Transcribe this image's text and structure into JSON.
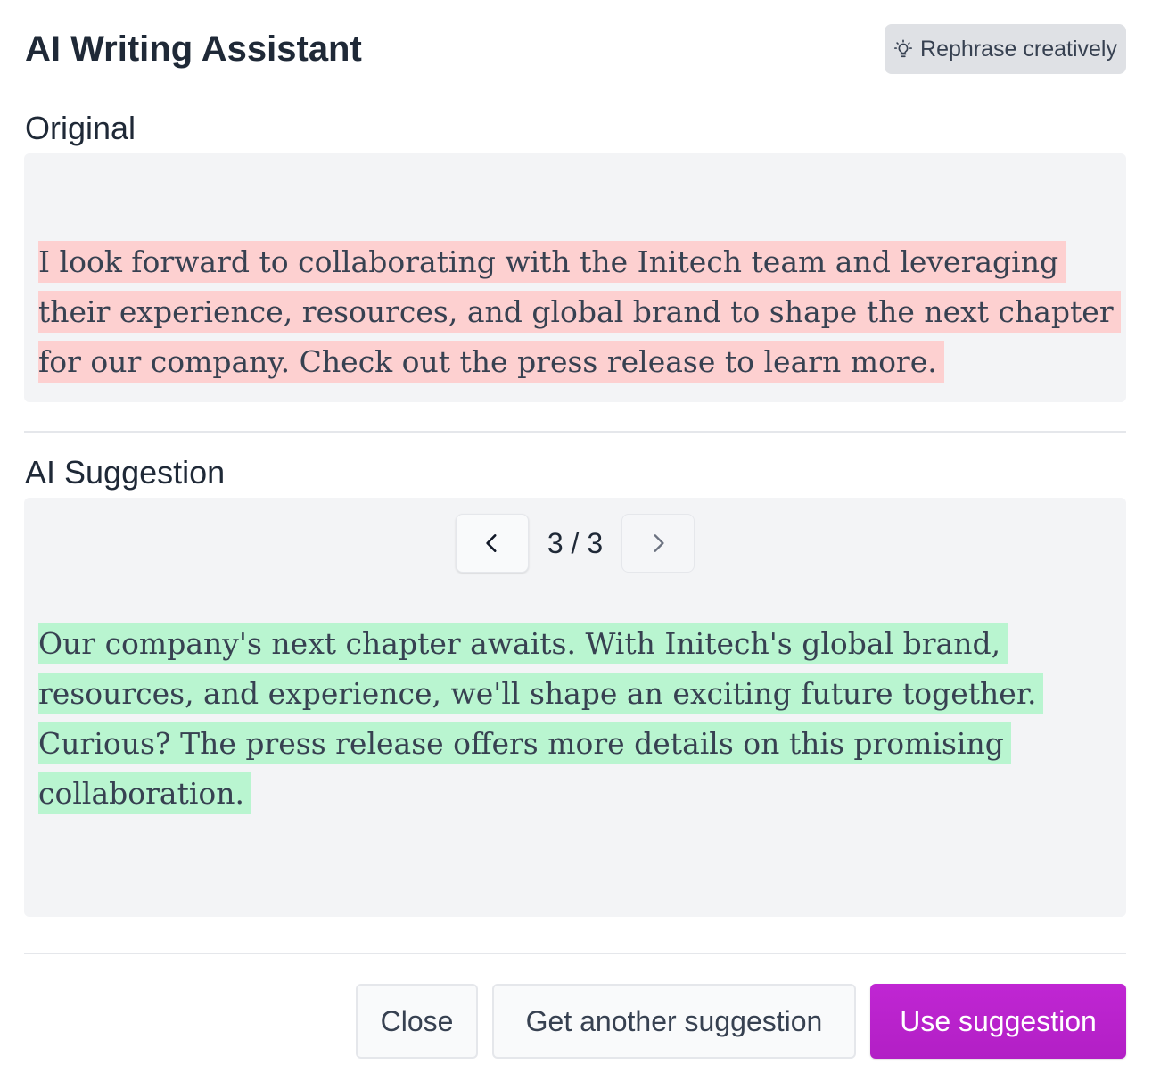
{
  "dialog": {
    "title": "AI Writing Assistant",
    "rephrase_button": {
      "label": "Rephrase creatively",
      "icon": "lightbulb-icon"
    }
  },
  "original": {
    "label": "Original",
    "text": "I look forward to collaborating with the Initech team and leveraging their experience, resources, and global brand to shape the next chapter for our company. Check out the press release to learn more."
  },
  "suggestion": {
    "label": "AI Suggestion",
    "pager": {
      "current": 3,
      "total": 3,
      "display": "3 / 3",
      "prev_icon": "chevron-left-icon",
      "next_icon": "chevron-right-icon"
    },
    "text": "Our company's next chapter awaits. With Initech's global brand, resources, and experience, we'll shape an exciting future together. Curious? The press release offers more details on this promising collaboration."
  },
  "footer": {
    "close_label": "Close",
    "another_label": "Get another suggestion",
    "use_label": "Use suggestion"
  },
  "colors": {
    "accent": "#c026d3",
    "removed_highlight": "#fdd0d0",
    "added_highlight": "#b9f5d0",
    "panel_bg": "#f3f4f6"
  }
}
